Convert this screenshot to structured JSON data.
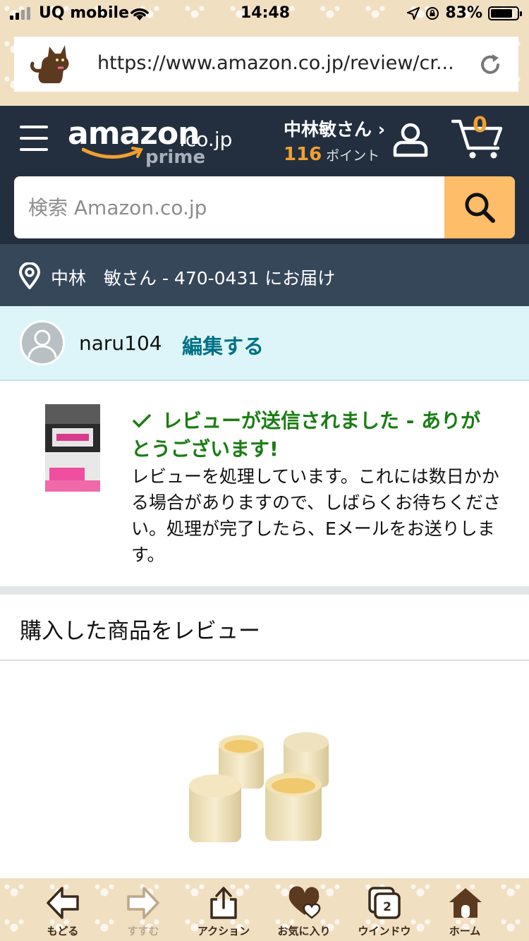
{
  "status_bar": {
    "carrier": "UQ mobile",
    "time": "14:48",
    "battery": "83%",
    "battery_level": 0.83
  },
  "browser": {
    "url": "https://www.amazon.co.jp/review/cr..."
  },
  "header": {
    "logo_text": "amazon",
    "logo_domain": ".co.jp",
    "logo_prime": "prime",
    "user_name": "中林敏さん ›",
    "points_value": "116",
    "points_label": "ポイント",
    "cart_count": "0"
  },
  "search": {
    "placeholder": "検索 Amazon.co.jp"
  },
  "delivery": {
    "text": "中林　敏さん - 470-0431 にお届け"
  },
  "profile": {
    "username": "naru104",
    "edit_label": "編集する"
  },
  "confirmation": {
    "title": "レビューが送信されました - ありがとうございます!",
    "body": "レビューを処理しています。これには数日かかる場合がありますので、しばらくお待ちください。処理が完了したら、Eメールをお送りします。"
  },
  "review_section": {
    "heading": "購入した商品をレビュー"
  },
  "toolbar": {
    "items": [
      {
        "label": "もどる",
        "icon": "back-arrow-icon"
      },
      {
        "label": "すすむ",
        "icon": "forward-arrow-icon"
      },
      {
        "label": "アクション",
        "icon": "share-icon"
      },
      {
        "label": "お気に入り",
        "icon": "heart-icon"
      },
      {
        "label": "ウインドウ",
        "icon": "windows-icon"
      },
      {
        "label": "ホーム",
        "icon": "home-icon"
      }
    ],
    "window_count": "2"
  },
  "colors": {
    "header_bg": "#232f3e",
    "delivery_bg": "#37475a",
    "search_button": "#febd69",
    "accent_orange": "#f0a030",
    "success_green": "#1b7d14",
    "link_teal": "#007185",
    "profile_bg": "#ddf5f9",
    "chrome_bg": "#f1dfc2"
  }
}
